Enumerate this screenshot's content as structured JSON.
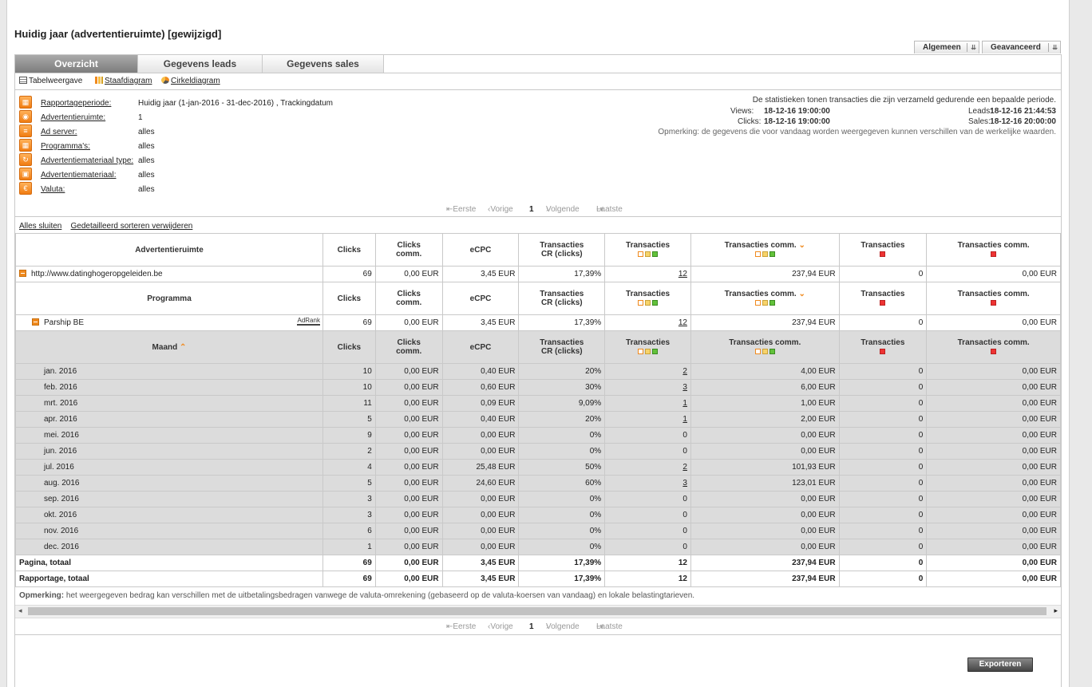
{
  "title": "Huidig jaar (advertentieruimte) [gewijzigd]",
  "top_buttons": {
    "general": "Algemeen",
    "advanced": "Geavanceerd"
  },
  "tabs": [
    "Overzicht",
    "Gegevens leads",
    "Gegevens sales"
  ],
  "views": {
    "table": "Tabelweergave",
    "bar": "Staafdiagram",
    "pie": "Cirkeldiagram"
  },
  "filters": [
    {
      "label": "Rapportageperiode:",
      "value": "Huidig jaar (1-jan-2016 - 31-dec-2016) , Trackingdatum"
    },
    {
      "label": "Advertentieruimte:",
      "value": "1"
    },
    {
      "label": "Ad server:",
      "value": "alles"
    },
    {
      "label": "Programma's:",
      "value": "alles"
    },
    {
      "label": "Advertentiemateriaal type:",
      "value": "alles"
    },
    {
      "label": "Advertentiemateriaal:",
      "value": "alles"
    },
    {
      "label": "Valuta:",
      "value": "alles"
    }
  ],
  "info": {
    "line1": "De statistieken tonen transacties die zijn verzameld gedurende een bepaalde periode.",
    "views_label": "Views:",
    "views_value": "18-12-16 19:00:00",
    "leads_label": "Leads:",
    "leads_value": "18-12-16 21:44:53",
    "clicks_label": "Clicks:",
    "clicks_value": "18-12-16 19:00:00",
    "sales_label": "Sales:",
    "sales_value": "18-12-16 20:00:00",
    "remark": "Opmerking: de gegevens die voor vandaag worden weergegeven kunnen verschillen van de werkelijke waarden."
  },
  "pager": {
    "first": "Eerste",
    "prev": "Vorige",
    "page": "1",
    "next": "Volgende",
    "last": "Laatste"
  },
  "actions": {
    "close_all": "Alles sluiten",
    "remove_sort": "Gedetailleerd sorteren verwijderen"
  },
  "columns": {
    "adspace": "Advertentieruimte",
    "program": "Programma",
    "month": "Maand",
    "clicks": "Clicks",
    "clicks_comm_1": "Clicks",
    "clicks_comm_2": "comm.",
    "ecpc": "eCPC",
    "cr_1": "Transacties",
    "cr_2": "CR (clicks)",
    "trans": "Transacties",
    "trans_comm": "Transacties comm.",
    "trans_r": "Transacties",
    "trans_comm_r": "Transacties comm."
  },
  "adspace_row": {
    "name": "http://www.datinghogeropgeleiden.be",
    "clicks": "69",
    "clicks_comm": "0,00 EUR",
    "ecpc": "3,45 EUR",
    "cr": "17,39%",
    "trans": "12",
    "trans_comm": "237,94 EUR",
    "trans_r": "0",
    "trans_comm_r": "0,00 EUR"
  },
  "program_row": {
    "name": "Parship BE",
    "badge": "AdRank",
    "clicks": "69",
    "clicks_comm": "0,00 EUR",
    "ecpc": "3,45 EUR",
    "cr": "17,39%",
    "trans": "12",
    "trans_comm": "237,94 EUR",
    "trans_r": "0",
    "trans_comm_r": "0,00 EUR"
  },
  "months": [
    {
      "m": "jan. 2016",
      "clicks": "10",
      "cc": "0,00 EUR",
      "ecpc": "0,40 EUR",
      "cr": "20%",
      "t": "2",
      "tc": "4,00 EUR",
      "tr": "0",
      "tcr": "0,00 EUR",
      "link": true
    },
    {
      "m": "feb. 2016",
      "clicks": "10",
      "cc": "0,00 EUR",
      "ecpc": "0,60 EUR",
      "cr": "30%",
      "t": "3",
      "tc": "6,00 EUR",
      "tr": "0",
      "tcr": "0,00 EUR",
      "link": true
    },
    {
      "m": "mrt. 2016",
      "clicks": "11",
      "cc": "0,00 EUR",
      "ecpc": "0,09 EUR",
      "cr": "9,09%",
      "t": "1",
      "tc": "1,00 EUR",
      "tr": "0",
      "tcr": "0,00 EUR",
      "link": true
    },
    {
      "m": "apr. 2016",
      "clicks": "5",
      "cc": "0,00 EUR",
      "ecpc": "0,40 EUR",
      "cr": "20%",
      "t": "1",
      "tc": "2,00 EUR",
      "tr": "0",
      "tcr": "0,00 EUR",
      "link": true
    },
    {
      "m": "mei. 2016",
      "clicks": "9",
      "cc": "0,00 EUR",
      "ecpc": "0,00 EUR",
      "cr": "0%",
      "t": "0",
      "tc": "0,00 EUR",
      "tr": "0",
      "tcr": "0,00 EUR",
      "link": false
    },
    {
      "m": "jun. 2016",
      "clicks": "2",
      "cc": "0,00 EUR",
      "ecpc": "0,00 EUR",
      "cr": "0%",
      "t": "0",
      "tc": "0,00 EUR",
      "tr": "0",
      "tcr": "0,00 EUR",
      "link": false
    },
    {
      "m": "jul. 2016",
      "clicks": "4",
      "cc": "0,00 EUR",
      "ecpc": "25,48 EUR",
      "cr": "50%",
      "t": "2",
      "tc": "101,93 EUR",
      "tr": "0",
      "tcr": "0,00 EUR",
      "link": true
    },
    {
      "m": "aug. 2016",
      "clicks": "5",
      "cc": "0,00 EUR",
      "ecpc": "24,60 EUR",
      "cr": "60%",
      "t": "3",
      "tc": "123,01 EUR",
      "tr": "0",
      "tcr": "0,00 EUR",
      "link": true
    },
    {
      "m": "sep. 2016",
      "clicks": "3",
      "cc": "0,00 EUR",
      "ecpc": "0,00 EUR",
      "cr": "0%",
      "t": "0",
      "tc": "0,00 EUR",
      "tr": "0",
      "tcr": "0,00 EUR",
      "link": false
    },
    {
      "m": "okt. 2016",
      "clicks": "3",
      "cc": "0,00 EUR",
      "ecpc": "0,00 EUR",
      "cr": "0%",
      "t": "0",
      "tc": "0,00 EUR",
      "tr": "0",
      "tcr": "0,00 EUR",
      "link": false
    },
    {
      "m": "nov. 2016",
      "clicks": "6",
      "cc": "0,00 EUR",
      "ecpc": "0,00 EUR",
      "cr": "0%",
      "t": "0",
      "tc": "0,00 EUR",
      "tr": "0",
      "tcr": "0,00 EUR",
      "link": false
    },
    {
      "m": "dec. 2016",
      "clicks": "1",
      "cc": "0,00 EUR",
      "ecpc": "0,00 EUR",
      "cr": "0%",
      "t": "0",
      "tc": "0,00 EUR",
      "tr": "0",
      "tcr": "0,00 EUR",
      "link": false
    }
  ],
  "totals": [
    {
      "label": "Pagina, totaal",
      "clicks": "69",
      "cc": "0,00 EUR",
      "ecpc": "3,45 EUR",
      "cr": "17,39%",
      "t": "12",
      "tc": "237,94 EUR",
      "tr": "0",
      "tcr": "0,00 EUR"
    },
    {
      "label": "Rapportage, totaal",
      "clicks": "69",
      "cc": "0,00 EUR",
      "ecpc": "3,45 EUR",
      "cr": "17,39%",
      "t": "12",
      "tc": "237,94 EUR",
      "tr": "0",
      "tcr": "0,00 EUR"
    }
  ],
  "note_label": "Opmerking:",
  "note_text": " het weergegeven bedrag kan verschillen met de uitbetalingsbedragen vanwege de valuta-omrekening (gebaseerd op de valuta-koersen van vandaag) en lokale belastingtarieven.",
  "export": "Exporteren",
  "icons": {
    "filter": "calendar-icon",
    "sort": "arrow-down-icon"
  },
  "colors": {
    "accent": "#f08a1e",
    "tab_active": "#8a8a8a"
  }
}
